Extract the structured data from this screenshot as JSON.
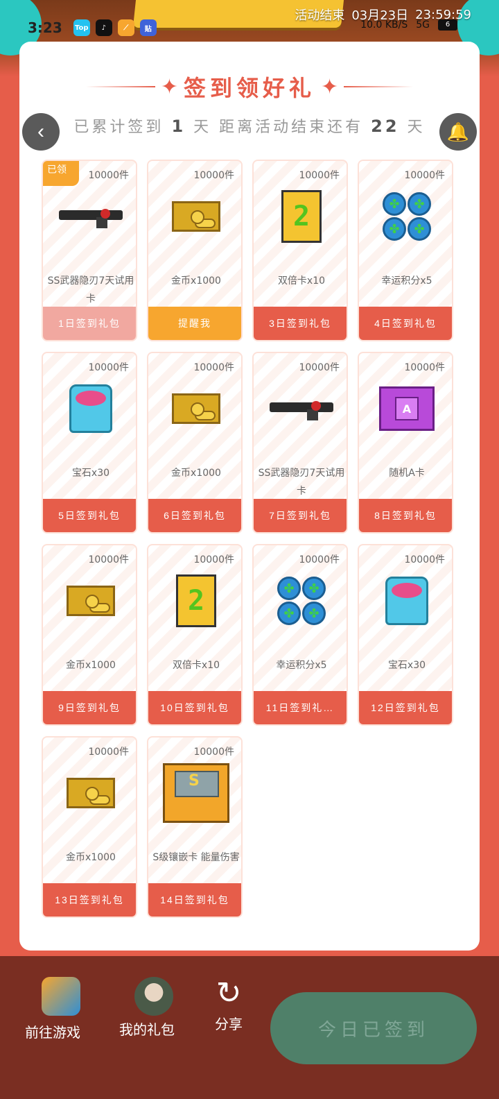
{
  "status_bar": {
    "time": "3:23",
    "net_speed": "10.0 KB/S",
    "network": "5G",
    "battery": "6",
    "apps": [
      "Top",
      "",
      "",
      "贴"
    ]
  },
  "countdown": {
    "label": "活动结束",
    "date": "03月23日",
    "time": "23:59:59"
  },
  "header": {
    "title": "签到领好礼",
    "info_prefix": "已累计签到",
    "signed_days": "1",
    "info_mid": "天 距离活动结束还有",
    "remaining_days": "22",
    "info_suffix": "天"
  },
  "rewards": [
    {
      "qty": "10000件",
      "name": "SS武器隐刃7天试用卡",
      "button": "1日签到礼包",
      "state": "done",
      "icon": "gun-icon",
      "claimed_tag": "已领"
    },
    {
      "qty": "10000件",
      "name": "金币x1000",
      "button": "提醒我",
      "state": "remind",
      "icon": "gold-chest-icon"
    },
    {
      "qty": "10000件",
      "name": "双倍卡x10",
      "button": "3日签到礼包",
      "state": "normal",
      "icon": "double-card-icon"
    },
    {
      "qty": "10000件",
      "name": "幸运积分x5",
      "button": "4日签到礼包",
      "state": "normal",
      "icon": "clover-icon"
    },
    {
      "qty": "10000件",
      "name": "宝石x30",
      "button": "5日签到礼包",
      "state": "normal",
      "icon": "gem-icon"
    },
    {
      "qty": "10000件",
      "name": "金币x1000",
      "button": "6日签到礼包",
      "state": "normal",
      "icon": "gold-chest-icon"
    },
    {
      "qty": "10000件",
      "name": "SS武器隐刃7天试用卡",
      "button": "7日签到礼包",
      "state": "normal",
      "icon": "gun-icon"
    },
    {
      "qty": "10000件",
      "name": "随机A卡",
      "button": "8日签到礼包",
      "state": "normal",
      "icon": "a-box-icon"
    },
    {
      "qty": "10000件",
      "name": "金币x1000",
      "button": "9日签到礼包",
      "state": "normal",
      "icon": "gold-chest-icon"
    },
    {
      "qty": "10000件",
      "name": "双倍卡x10",
      "button": "10日签到礼包",
      "state": "normal",
      "icon": "double-card-icon"
    },
    {
      "qty": "10000件",
      "name": "幸运积分x5",
      "button": "11日签到礼…",
      "state": "normal",
      "icon": "clover-icon"
    },
    {
      "qty": "10000件",
      "name": "宝石x30",
      "button": "12日签到礼包",
      "state": "normal",
      "icon": "gem-icon"
    },
    {
      "qty": "10000件",
      "name": "金币x1000",
      "button": "13日签到礼包",
      "state": "normal",
      "icon": "gold-chest-icon"
    },
    {
      "qty": "10000件",
      "name": "S级镶嵌卡 能量伤害",
      "button": "14日签到礼包",
      "state": "normal",
      "icon": "s-box-icon"
    }
  ],
  "bottom": {
    "goto_game": "前往游戏",
    "my_gifts": "我的礼包",
    "share": "分享",
    "checkin": "今日已签到"
  },
  "colors": {
    "primary": "#e65d4a",
    "remind": "#f7a62f",
    "done": "#f1a8a0",
    "bottom_bar": "#7a2e22",
    "checkin_disabled": "#4f8069"
  }
}
